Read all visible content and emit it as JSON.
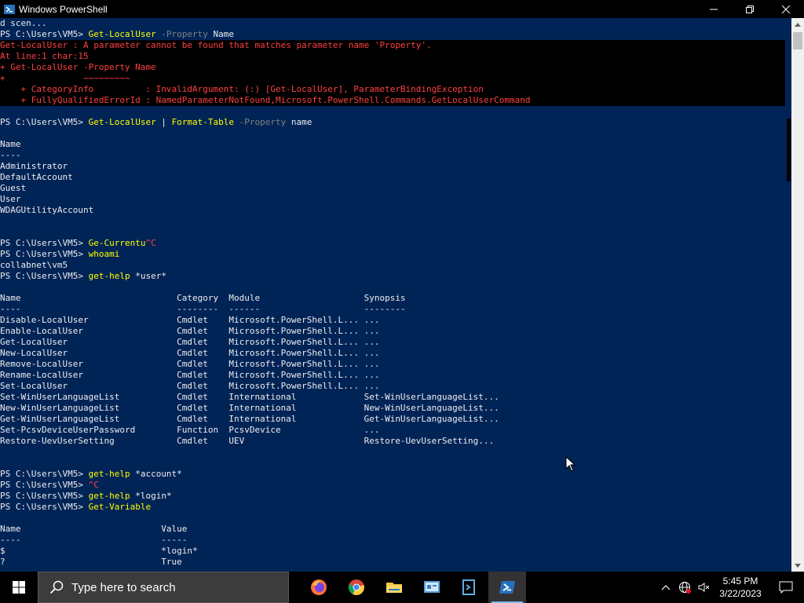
{
  "window": {
    "title": "Windows PowerShell"
  },
  "console": {
    "lines": [
      {
        "t": "d scen...",
        "k": "plain"
      },
      {
        "segs": [
          {
            "t": "PS C:\\Users\\VM5> ",
            "c": "plain"
          },
          {
            "t": "Get-LocalUser",
            "c": "cmd"
          },
          {
            "t": " -Property",
            "c": "par"
          },
          {
            "t": " Name",
            "c": "plain"
          }
        ]
      },
      {
        "t": "Get-LocalUser : A parameter cannot be found that matches parameter name 'Property'.",
        "k": "err"
      },
      {
        "t": "At line:1 char:15",
        "k": "err"
      },
      {
        "t": "+ Get-LocalUser -Property Name",
        "k": "err"
      },
      {
        "t": "+               ~~~~~~~~~",
        "k": "err"
      },
      {
        "t": "    + CategoryInfo          : InvalidArgument: (:) [Get-LocalUser], ParameterBindingException",
        "k": "err"
      },
      {
        "t": "    + FullyQualifiedErrorId : NamedParameterNotFound,Microsoft.PowerShell.Commands.GetLocalUserCommand",
        "k": "err"
      },
      {
        "t": "",
        "k": "plain"
      },
      {
        "segs": [
          {
            "t": "PS C:\\Users\\VM5> ",
            "c": "plain"
          },
          {
            "t": "Get-LocalUser",
            "c": "cmd"
          },
          {
            "t": " | ",
            "c": "plain"
          },
          {
            "t": "Format-Table",
            "c": "cmd"
          },
          {
            "t": " -Property",
            "c": "par"
          },
          {
            "t": " name",
            "c": "plain"
          }
        ]
      },
      {
        "t": "",
        "k": "plain"
      },
      {
        "t": "Name",
        "k": "plain"
      },
      {
        "t": "----",
        "k": "plain"
      },
      {
        "t": "Administrator",
        "k": "plain"
      },
      {
        "t": "DefaultAccount",
        "k": "plain"
      },
      {
        "t": "Guest",
        "k": "plain"
      },
      {
        "t": "User",
        "k": "plain"
      },
      {
        "t": "WDAGUtilityAccount",
        "k": "plain"
      },
      {
        "t": "",
        "k": "plain"
      },
      {
        "t": "",
        "k": "plain"
      },
      {
        "segs": [
          {
            "t": "PS C:\\Users\\VM5> ",
            "c": "plain"
          },
          {
            "t": "Ge-Currentu",
            "c": "cmd"
          },
          {
            "t": "^C",
            "c": "err"
          }
        ]
      },
      {
        "segs": [
          {
            "t": "PS C:\\Users\\VM5> ",
            "c": "plain"
          },
          {
            "t": "whoami",
            "c": "cmd"
          }
        ]
      },
      {
        "t": "collabnet\\vm5",
        "k": "plain"
      },
      {
        "segs": [
          {
            "t": "PS C:\\Users\\VM5> ",
            "c": "plain"
          },
          {
            "t": "get-help",
            "c": "cmd"
          },
          {
            "t": " *user*",
            "c": "plain"
          }
        ]
      },
      {
        "t": "",
        "k": "plain"
      },
      {
        "t": "Name                              Category  Module                    Synopsis",
        "k": "plain"
      },
      {
        "t": "----                              --------  ------                    --------",
        "k": "plain"
      },
      {
        "t": "Disable-LocalUser                 Cmdlet    Microsoft.PowerShell.L... ...",
        "k": "plain"
      },
      {
        "t": "Enable-LocalUser                  Cmdlet    Microsoft.PowerShell.L... ...",
        "k": "plain"
      },
      {
        "t": "Get-LocalUser                     Cmdlet    Microsoft.PowerShell.L... ...",
        "k": "plain"
      },
      {
        "t": "New-LocalUser                     Cmdlet    Microsoft.PowerShell.L... ...",
        "k": "plain"
      },
      {
        "t": "Remove-LocalUser                  Cmdlet    Microsoft.PowerShell.L... ...",
        "k": "plain"
      },
      {
        "t": "Rename-LocalUser                  Cmdlet    Microsoft.PowerShell.L... ...",
        "k": "plain"
      },
      {
        "t": "Set-LocalUser                     Cmdlet    Microsoft.PowerShell.L... ...",
        "k": "plain"
      },
      {
        "t": "Set-WinUserLanguageList           Cmdlet    International             Set-WinUserLanguageList...",
        "k": "plain"
      },
      {
        "t": "New-WinUserLanguageList           Cmdlet    International             New-WinUserLanguageList...",
        "k": "plain"
      },
      {
        "t": "Get-WinUserLanguageList           Cmdlet    International             Get-WinUserLanguageList...",
        "k": "plain"
      },
      {
        "t": "Set-PcsvDeviceUserPassword        Function  PcsvDevice                ...",
        "k": "plain"
      },
      {
        "t": "Restore-UevUserSetting            Cmdlet    UEV                       Restore-UevUserSetting...",
        "k": "plain"
      },
      {
        "t": "",
        "k": "plain"
      },
      {
        "t": "",
        "k": "plain"
      },
      {
        "segs": [
          {
            "t": "PS C:\\Users\\VM5> ",
            "c": "plain"
          },
          {
            "t": "get-help",
            "c": "cmd"
          },
          {
            "t": " *account*",
            "c": "plain"
          }
        ]
      },
      {
        "segs": [
          {
            "t": "PS C:\\Users\\VM5> ",
            "c": "plain"
          },
          {
            "t": "^C",
            "c": "err"
          }
        ]
      },
      {
        "segs": [
          {
            "t": "PS C:\\Users\\VM5> ",
            "c": "plain"
          },
          {
            "t": "get-help",
            "c": "cmd"
          },
          {
            "t": " *login*",
            "c": "plain"
          }
        ]
      },
      {
        "segs": [
          {
            "t": "PS C:\\Users\\VM5> ",
            "c": "plain"
          },
          {
            "t": "Get-Variable",
            "c": "cmd"
          }
        ]
      },
      {
        "t": "",
        "k": "plain"
      },
      {
        "t": "Name                           Value",
        "k": "plain"
      },
      {
        "t": "----                           -----",
        "k": "plain"
      },
      {
        "t": "$                              *login*",
        "k": "plain"
      },
      {
        "t": "?                              True",
        "k": "plain"
      }
    ]
  },
  "taskbar": {
    "search_placeholder": "Type here to search",
    "clock_time": "5:45 PM",
    "clock_date": "3/22/2023"
  },
  "colors": {
    "console_bg": "#012456",
    "error": "#ff4040",
    "command": "#ffff00",
    "parameter": "#808080"
  }
}
